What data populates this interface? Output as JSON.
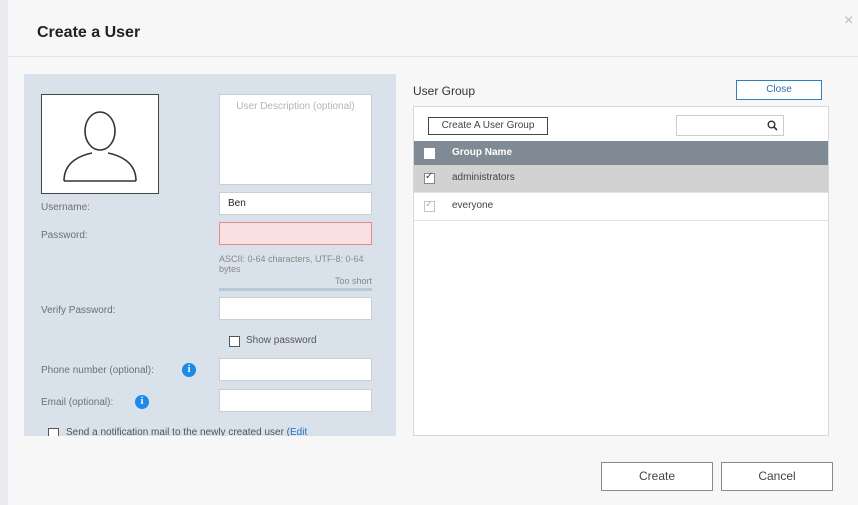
{
  "dialog": {
    "title": "Create a User",
    "close_glyph": "×"
  },
  "form": {
    "description_placeholder": "User Description (optional)",
    "username_label": "Username:",
    "username_value": "Ben",
    "password_label": "Password:",
    "password_hint": "ASCII: 0-64 characters, UTF-8: 0-64 bytes",
    "password_strength": "Too short",
    "verify_password_label": "Verify Password:",
    "show_password_label": "Show password",
    "phone_label": "Phone number (optional):",
    "email_label": "Email (optional):",
    "notify_label": "Send a notification mail to the newly created user (",
    "notify_link": "Edit"
  },
  "user_group": {
    "title": "User Group",
    "close_label": "Close",
    "create_group_label": "Create A User Group",
    "column_header": "Group Name",
    "rows": [
      {
        "name": "administrators",
        "checked": true,
        "selected": true
      },
      {
        "name": "everyone",
        "checked": true,
        "disabled": true
      }
    ]
  },
  "footer": {
    "create_label": "Create",
    "cancel_label": "Cancel"
  },
  "colors": {
    "left_panel_bg": "#d9e2ea",
    "header_bg": "#808a95",
    "error_bg": "#fbe0e1",
    "info_icon": "#1a8be8",
    "link": "#1a73c9"
  },
  "icons": [
    "avatar-placeholder-icon",
    "info-icon",
    "search-icon",
    "close-icon"
  ]
}
